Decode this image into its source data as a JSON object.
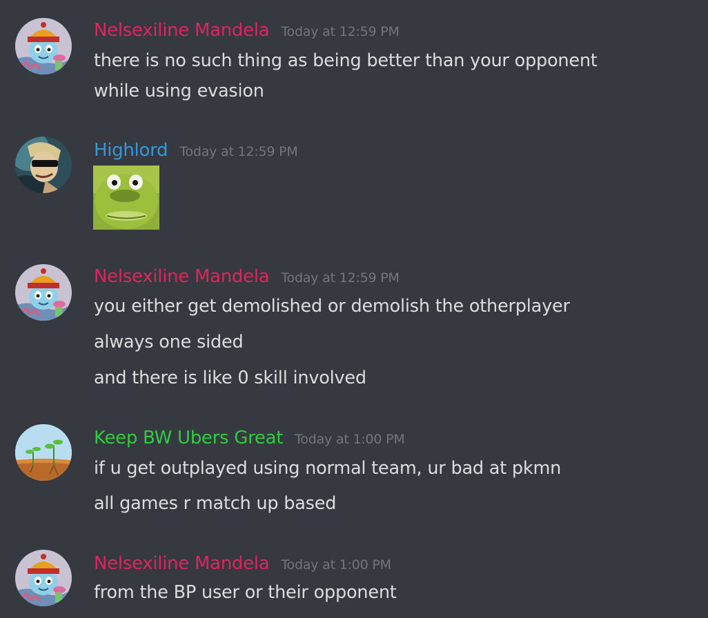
{
  "colors": {
    "background": "#36393f",
    "message_text": "#dcddde",
    "timestamp": "#72767d",
    "user_nelsexiline": "#e0245e",
    "user_highlord": "#3498db",
    "user_keepbw": "#2ecc40"
  },
  "messages": [
    {
      "username": "Nelsexiline Mandela",
      "timestamp": "Today at 12:59 PM",
      "avatar": "nelsexiline-avatar-icon",
      "lines": [
        "there is no such thing as being better than your opponent",
        "while using evasion"
      ]
    },
    {
      "username": "Highlord",
      "timestamp": "Today at 12:59 PM",
      "avatar": "highlord-avatar-icon",
      "attachment": "green-face-emoji-image"
    },
    {
      "username": "Nelsexiline Mandela",
      "timestamp": "Today at 12:59 PM",
      "avatar": "nelsexiline-avatar-icon",
      "lines": [
        "you either get demolished or demolish the otherplayer",
        "always one sided",
        "and there is like 0 skill involved"
      ]
    },
    {
      "username": "Keep BW Ubers Great",
      "timestamp": "Today at 1:00 PM",
      "avatar": "sprout-avatar-icon",
      "lines": [
        "if u get outplayed using normal team, ur bad at pkmn",
        "all games r match up based"
      ]
    },
    {
      "username": "Nelsexiline Mandela",
      "timestamp": "Today at 1:00 PM",
      "avatar": "nelsexiline-avatar-icon",
      "lines": [
        "from the BP user or their opponent"
      ]
    }
  ]
}
